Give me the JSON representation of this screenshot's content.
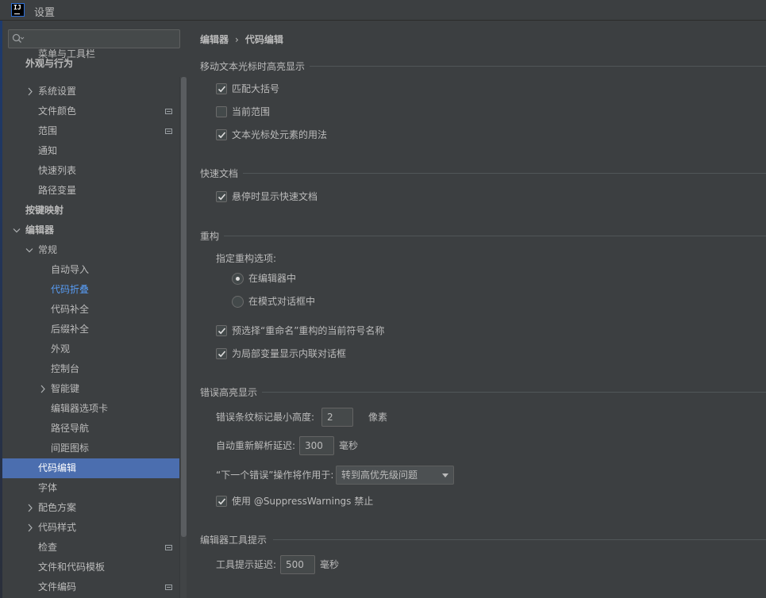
{
  "window": {
    "title": "设置",
    "app_icon_text": "IJ"
  },
  "search": {
    "placeholder": "",
    "value": ""
  },
  "sidebar": {
    "items": [
      {
        "label": "菜单与工具栏"
      },
      {
        "label": "外观与行为"
      },
      {
        "label": "系统设置"
      },
      {
        "label": "文件颜色"
      },
      {
        "label": "范围"
      },
      {
        "label": "通知"
      },
      {
        "label": "快速列表"
      },
      {
        "label": "路径变量"
      },
      {
        "label": "按键映射"
      },
      {
        "label": "编辑器"
      },
      {
        "label": "常规"
      },
      {
        "label": "自动导入"
      },
      {
        "label": "代码折叠"
      },
      {
        "label": "代码补全"
      },
      {
        "label": "后缀补全"
      },
      {
        "label": "外观"
      },
      {
        "label": "控制台"
      },
      {
        "label": "智能键"
      },
      {
        "label": "编辑器选项卡"
      },
      {
        "label": "路径导航"
      },
      {
        "label": "间距图标"
      },
      {
        "label": "代码编辑"
      },
      {
        "label": "字体"
      },
      {
        "label": "配色方案"
      },
      {
        "label": "代码样式"
      },
      {
        "label": "检查"
      },
      {
        "label": "文件和代码模板"
      },
      {
        "label": "文件编码"
      }
    ]
  },
  "breadcrumb": {
    "parent": "编辑器",
    "separator": "›",
    "current": "代码编辑"
  },
  "sections": {
    "highlight": {
      "title": "移动文本光标时高亮显示",
      "match_braces": {
        "label": "匹配大括号",
        "checked": true
      },
      "current_scope": {
        "label": "当前范围",
        "checked": false
      },
      "usages": {
        "label": "文本光标处元素的用法",
        "checked": true
      }
    },
    "quick_doc": {
      "title": "快速文档",
      "hover": {
        "label": "悬停时显示快速文档",
        "checked": true
      }
    },
    "refactor": {
      "title": "重构",
      "options_label": "指定重构选项:",
      "in_editor": {
        "label": "在编辑器中",
        "selected": true
      },
      "in_dialog": {
        "label": "在模式对话框中",
        "selected": false
      },
      "preselect": {
        "label": "预选择“重命名”重构的当前符号名称",
        "checked": true
      },
      "inline_dialog": {
        "label": "为局部变量显示内联对话框",
        "checked": true
      }
    },
    "errors": {
      "title": "错误高亮显示",
      "min_height_label": "错误条纹标记最小高度:",
      "min_height_value": "2",
      "min_height_unit": "像素",
      "reparse_label": "自动重新解析延迟:",
      "reparse_value": "300",
      "reparse_unit": "毫秒",
      "next_error_label": "“下一个错误”操作将作用于:",
      "next_error_value": "转到高优先级问题",
      "suppress": {
        "label": "使用 @SuppressWarnings 禁止",
        "checked": true
      }
    },
    "tooltips": {
      "title": "编辑器工具提示",
      "delay_label": "工具提示延迟:",
      "delay_value": "500",
      "delay_unit": "毫秒"
    }
  }
}
